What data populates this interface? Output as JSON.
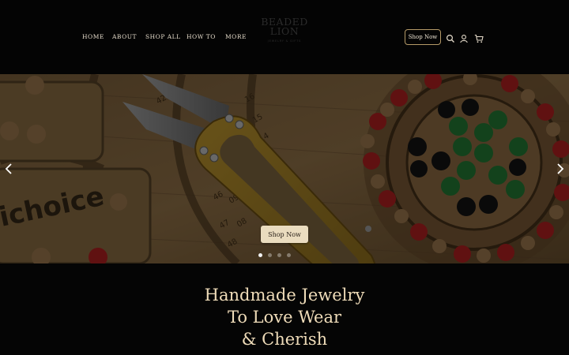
{
  "nav": {
    "items": [
      {
        "label": "HOME"
      },
      {
        "label": "ABOUT"
      },
      {
        "label": "SHOP ALL"
      },
      {
        "label": "HOW TO"
      },
      {
        "label": "MORE"
      }
    ]
  },
  "logo": {
    "line1": "BEADED",
    "line2": "LION",
    "tagline": "JEWELRY & GIFTS"
  },
  "header": {
    "shop_now_label": "Shop Now",
    "icons": [
      "search-icon",
      "user-icon",
      "cart-icon"
    ]
  },
  "hero": {
    "shop_now_label": "Shop Now",
    "slide_count": 4,
    "active_slide": 1,
    "board_text": "ichoice",
    "ruler_labels": [
      "42",
      "16",
      "45",
      "15",
      "14",
      "46",
      "09",
      "47",
      "08",
      "48",
      "09"
    ]
  },
  "headline": {
    "line1": "Handmade Jewelry",
    "line2": "To Love Wear",
    "line3": "& Cherish"
  },
  "colors": {
    "background": "#050505",
    "accent_gold": "#b59a68",
    "headline": "#efdcb9",
    "button_fill": "#eadcbf"
  }
}
